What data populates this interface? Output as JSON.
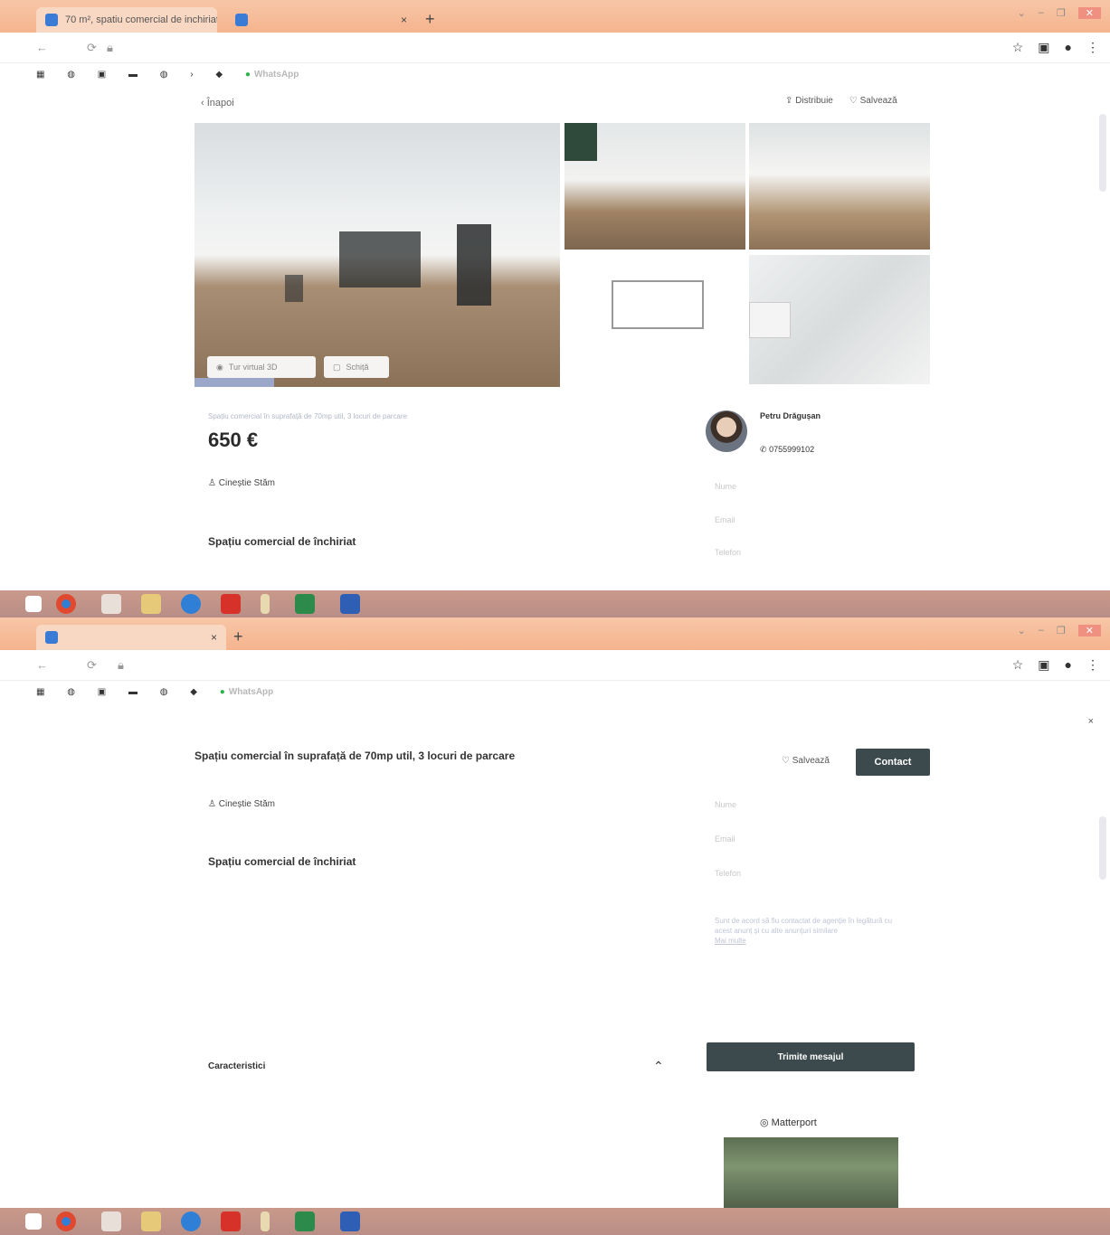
{
  "screenshot_1": {
    "browser": {
      "tabs": [
        {
          "title": "70 m², spatiu comercial de inchiriat",
          "active": true
        },
        {
          "title": "",
          "active": false
        }
      ],
      "new_tab_label": "+",
      "url": "",
      "bookmarks": [
        "",
        "",
        "",
        "",
        "",
        "",
        "",
        "",
        "WhatsApp"
      ]
    },
    "nav": {
      "back_label": "Înapoi",
      "share_label": "Distribuie",
      "save_label": "Salvează"
    },
    "gallery": {
      "tour_label": "Tur virtual 3D",
      "plan_label": "Schiță"
    },
    "listing": {
      "subtitle": "Spațiu comercial în suprafață de 70mp util, 3 locuri de parcare",
      "price": "650 €",
      "seller": "Cineștie Stăm",
      "section_title": "Spațiu comercial de închiriat"
    },
    "agent": {
      "name": "Petru Drăgușan",
      "phone": "0755999102"
    },
    "form": {
      "name_placeholder": "Nume",
      "email_placeholder": "Email",
      "phone_placeholder": "Telefon"
    }
  },
  "screenshot_2": {
    "browser": {
      "tabs": [
        {
          "title": "",
          "active": true
        }
      ],
      "new_tab_label": "+"
    },
    "header": {
      "title": "Spațiu comercial în suprafață de 70mp util, 3 locuri de parcare",
      "save_label": "Salvează",
      "contact_label": "Contact"
    },
    "listing": {
      "seller": "Cineștie Stăm",
      "section_title": "Spațiu comercial de închiriat",
      "features_title": "Caracteristici"
    },
    "form": {
      "name_placeholder": "Nume",
      "email_placeholder": "Email",
      "phone_placeholder": "Telefon",
      "consent_text": "Sunt de acord să fiu contactat de agenție în legătură cu acest anunț și cu alte anunțuri similare",
      "consent_link": "Mai multe",
      "send_label": "Trimite mesajul"
    },
    "matterport": {
      "label": "Matterport"
    }
  },
  "taskbar": {
    "items": [
      "",
      "",
      "",
      "",
      "",
      "",
      "",
      "",
      ""
    ],
    "colors": {
      "chrome": "#e0492f",
      "edge": "#2f7fd6",
      "pdf": "#d6322a",
      "word": "#2f5fb5",
      "excel": "#2c8a4b"
    }
  }
}
